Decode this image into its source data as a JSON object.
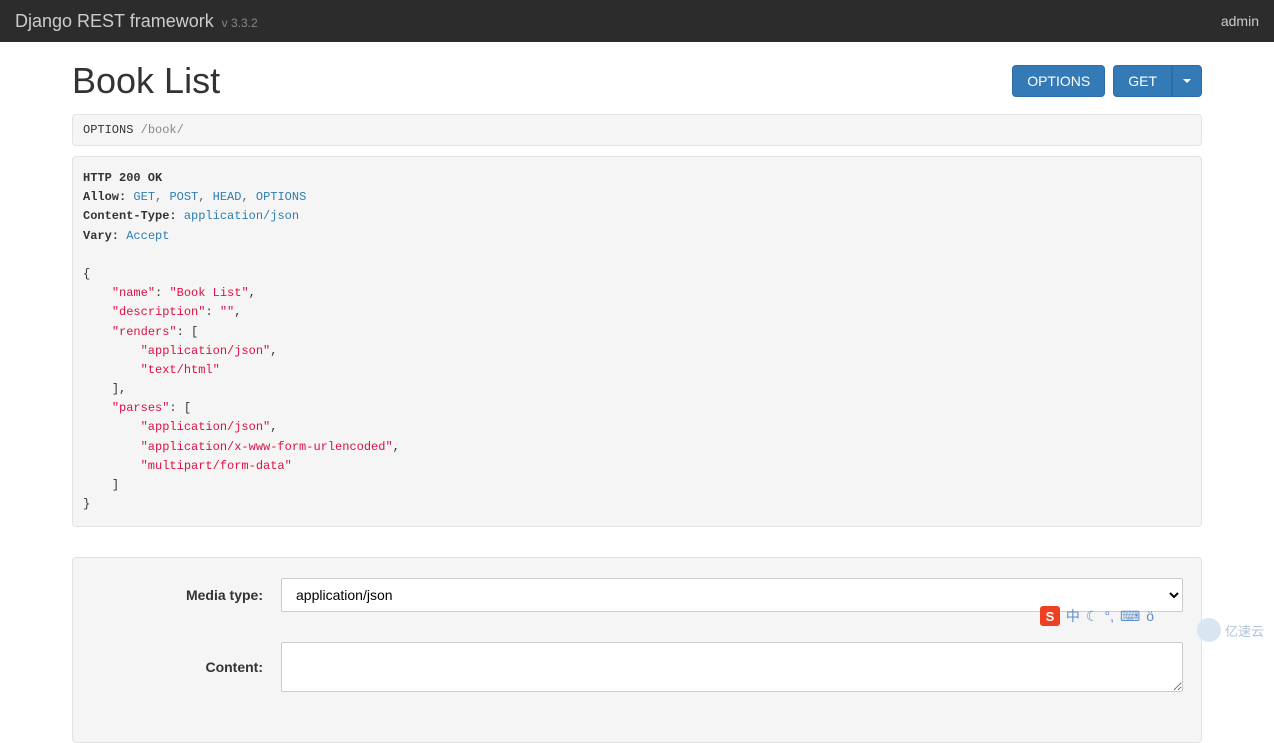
{
  "navbar": {
    "brand": "Django REST framework",
    "version": "v 3.3.2",
    "user": "admin"
  },
  "page": {
    "title": "Book List"
  },
  "buttons": {
    "options": "OPTIONS",
    "get": "GET"
  },
  "request": {
    "method": "OPTIONS",
    "path": "/book/"
  },
  "response": {
    "status_line": "HTTP 200 OK",
    "headers": {
      "allow_label": "Allow:",
      "allow_values": [
        "GET",
        "POST",
        "HEAD",
        "OPTIONS"
      ],
      "content_type_label": "Content-Type:",
      "content_type_value": "application/json",
      "vary_label": "Vary:",
      "vary_value": "Accept"
    },
    "body": {
      "name_key": "\"name\"",
      "name_val": "\"Book List\"",
      "description_key": "\"description\"",
      "description_val": "\"\"",
      "renders_key": "\"renders\"",
      "renders": [
        "\"application/json\"",
        "\"text/html\""
      ],
      "parses_key": "\"parses\"",
      "parses": [
        "\"application/json\"",
        "\"application/x-www-form-urlencoded\"",
        "\"multipart/form-data\""
      ]
    }
  },
  "form": {
    "media_type_label": "Media type:",
    "media_type_value": "application/json",
    "content_label": "Content:",
    "content_value": ""
  },
  "watermark": {
    "text": "亿速云"
  },
  "ime": {
    "s": "S",
    "zh": "中"
  }
}
